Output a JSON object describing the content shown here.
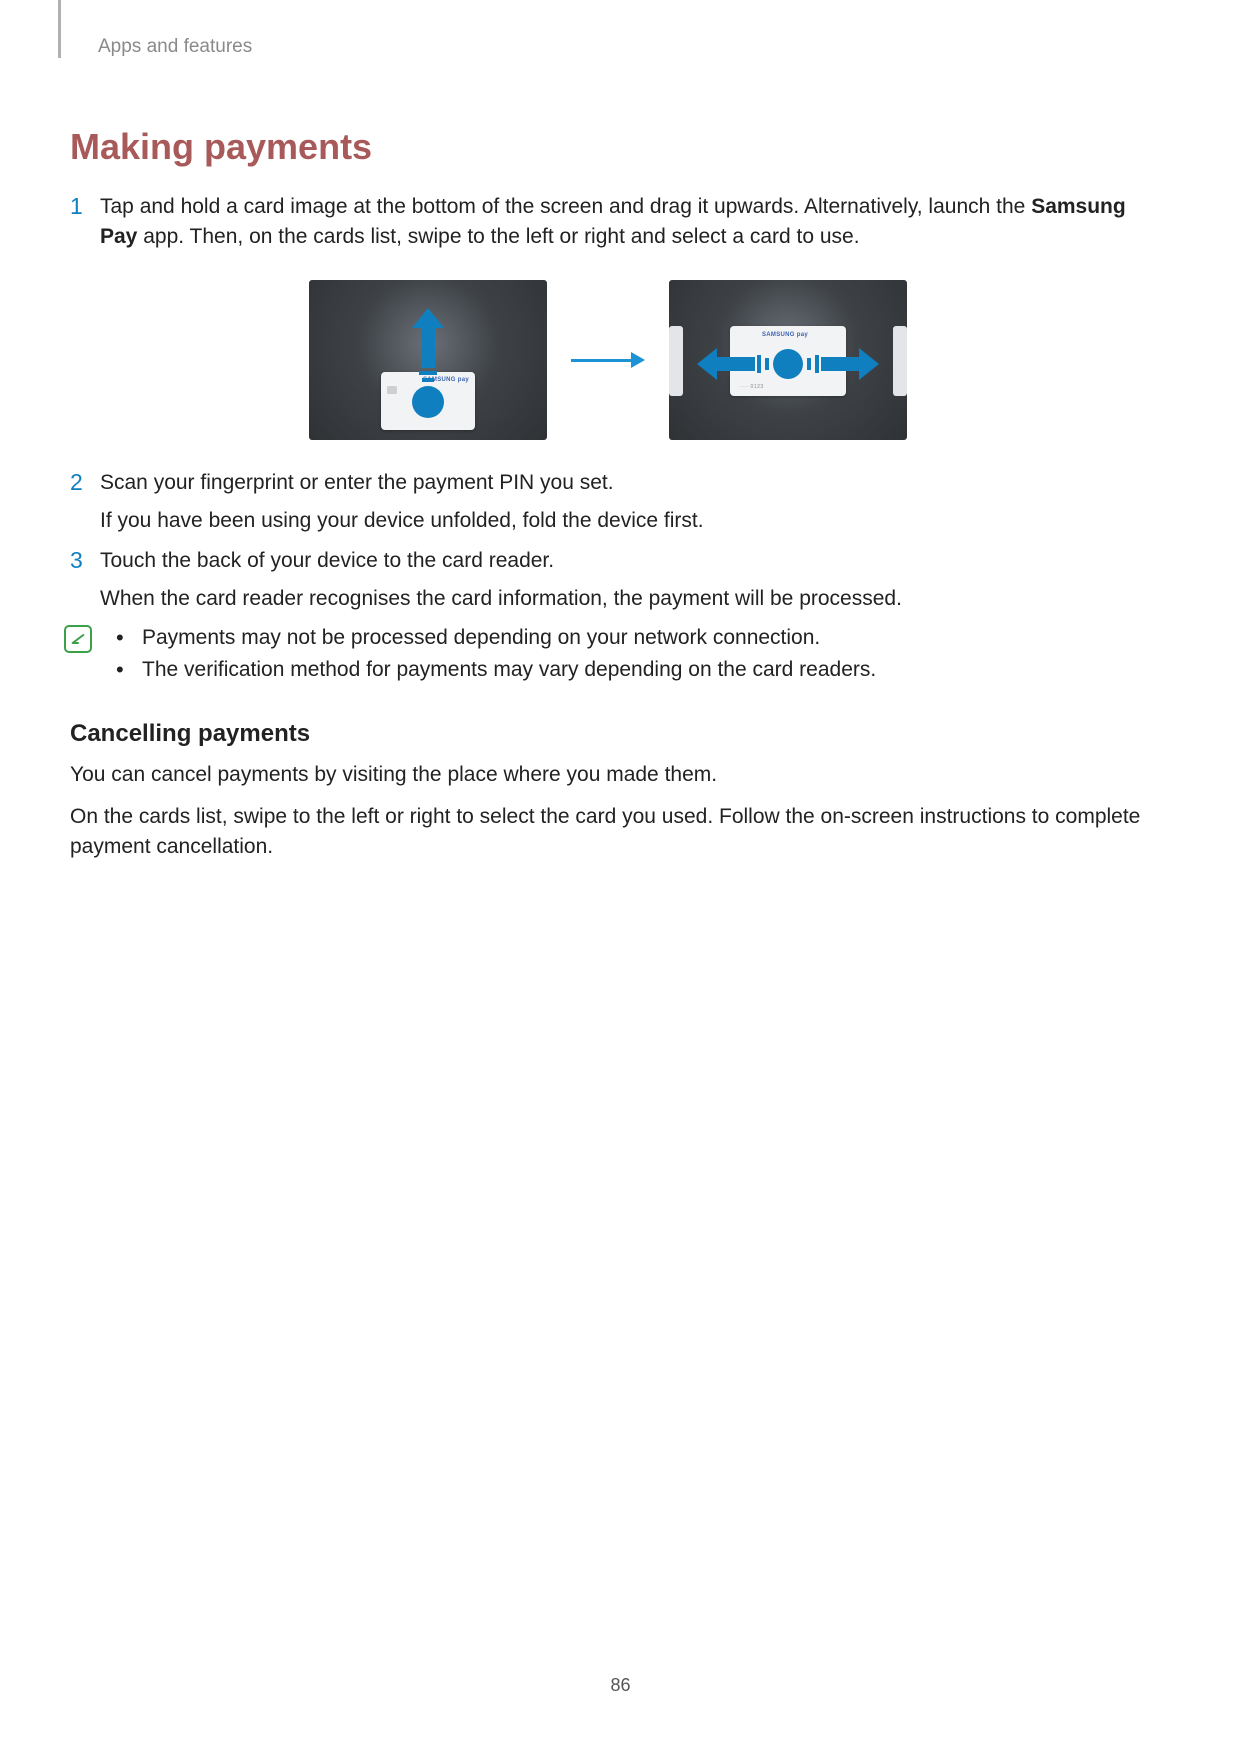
{
  "header": {
    "breadcrumb": "Apps and features"
  },
  "title": "Making payments",
  "steps": {
    "s1": {
      "num": "1",
      "text_a": "Tap and hold a card image at the bottom of the screen and drag it upwards. Alternatively, launch the ",
      "bold": "Samsung Pay",
      "text_b": " app. Then, on the cards list, swipe to the left or right and select a card to use."
    },
    "s2": {
      "num": "2",
      "line1": "Scan your fingerprint or enter the payment PIN you set.",
      "line2": "If you have been using your device unfolded, fold the device first."
    },
    "s3": {
      "num": "3",
      "line1": "Touch the back of your device to the card reader.",
      "line2": "When the card reader recognises the card information, the payment will be processed."
    }
  },
  "figure": {
    "card_brand_a": "SAMSUNG",
    "card_brand_b": "pay",
    "card_number": "···· 0123"
  },
  "notes": {
    "n1": "Payments may not be processed depending on your network connection.",
    "n2": "The verification method for payments may vary depending on the card readers."
  },
  "sub": {
    "heading": "Cancelling payments",
    "p1": "You can cancel payments by visiting the place where you made them.",
    "p2": "On the cards list, swipe to the left or right to select the card you used. Follow the on-screen instructions to complete payment cancellation."
  },
  "page_number": "86"
}
